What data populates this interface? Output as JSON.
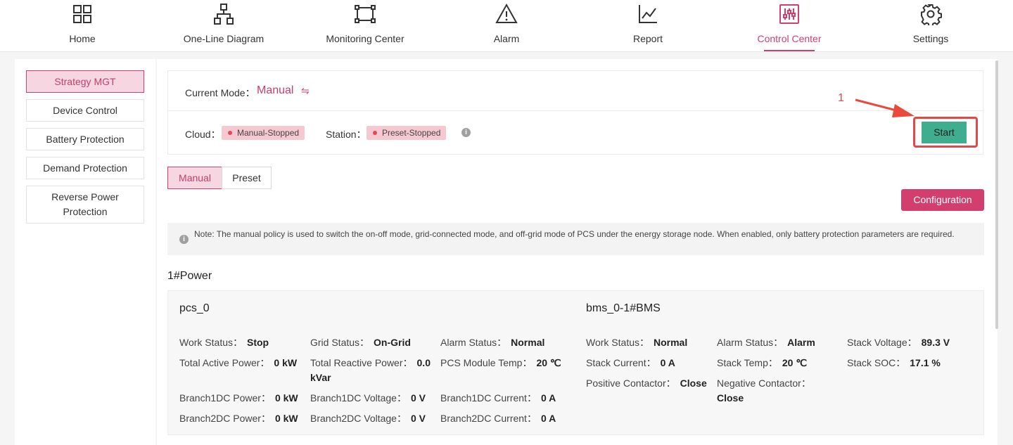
{
  "nav": {
    "items": [
      {
        "label": "Home",
        "icon": "grid-icon"
      },
      {
        "label": "One-Line Diagram",
        "icon": "hierarchy-icon"
      },
      {
        "label": "Monitoring Center",
        "icon": "monitor-frame-icon"
      },
      {
        "label": "Alarm",
        "icon": "warning-triangle-icon"
      },
      {
        "label": "Report",
        "icon": "line-chart-icon"
      },
      {
        "label": "Control Center",
        "icon": "sliders-icon",
        "active": true
      },
      {
        "label": "Settings",
        "icon": "gear-icon"
      }
    ]
  },
  "sidebar": {
    "items": [
      {
        "label": "Strategy MGT",
        "active": true
      },
      {
        "label": "Device Control"
      },
      {
        "label": "Battery Protection"
      },
      {
        "label": "Demand Protection"
      },
      {
        "label": "Reverse Power Protection"
      }
    ]
  },
  "mode": {
    "label": "Current Mode：",
    "value": "Manual",
    "swap_icon": "⇋"
  },
  "status": {
    "cloud_label": "Cloud：",
    "cloud_value": "Manual-Stopped",
    "station_label": "Station：",
    "station_value": "Preset-Stopped"
  },
  "annotation": {
    "number": "1"
  },
  "start_label": "Start",
  "tabs": [
    {
      "label": "Manual",
      "active": true
    },
    {
      "label": "Preset"
    }
  ],
  "config_label": "Configuration",
  "note": "Note: The manual policy is used to switch the on-off mode, grid-connected mode, and off-grid mode of PCS under the energy storage node. When enabled, only battery protection parameters are required.",
  "section_title": "1#Power",
  "pcs": {
    "title": "pcs_0",
    "fields": [
      {
        "label": "Work Status：",
        "value": "Stop"
      },
      {
        "label": "Grid Status：",
        "value": "On-Grid"
      },
      {
        "label": "Alarm Status：",
        "value": "Normal"
      },
      {
        "label": "Total Active Power：",
        "value": "0 kW"
      },
      {
        "label": "Total Reactive Power：",
        "value": "0.0 kVar"
      },
      {
        "label": "PCS Module Temp：",
        "value": "20 ℃"
      },
      {
        "label": "Branch1DC Power：",
        "value": "0 kW"
      },
      {
        "label": "Branch1DC Voltage：",
        "value": "0 V"
      },
      {
        "label": "Branch1DC Current：",
        "value": "0 A"
      },
      {
        "label": "Branch2DC Power：",
        "value": "0 kW"
      },
      {
        "label": "Branch2DC Voltage：",
        "value": "0 V"
      },
      {
        "label": "Branch2DC Current：",
        "value": "0 A"
      }
    ]
  },
  "bms": {
    "title": "bms_0-1#BMS",
    "fields": [
      {
        "label": "Work Status：",
        "value": "Normal"
      },
      {
        "label": "Alarm Status：",
        "value": "Alarm"
      },
      {
        "label": "Stack Voltage：",
        "value": "89.3 V"
      },
      {
        "label": "Stack Current：",
        "value": "0 A"
      },
      {
        "label": "Stack Temp：",
        "value": "20 ℃"
      },
      {
        "label": "Stack SOC：",
        "value": "17.1 %"
      },
      {
        "label": "Positive Contactor：",
        "value": "Close"
      },
      {
        "label": "Negative Contactor：",
        "value": "Close"
      }
    ]
  },
  "colors": {
    "accent": "#d23f6e",
    "start": "#3fae8f",
    "annotation": "#e84a3c"
  }
}
